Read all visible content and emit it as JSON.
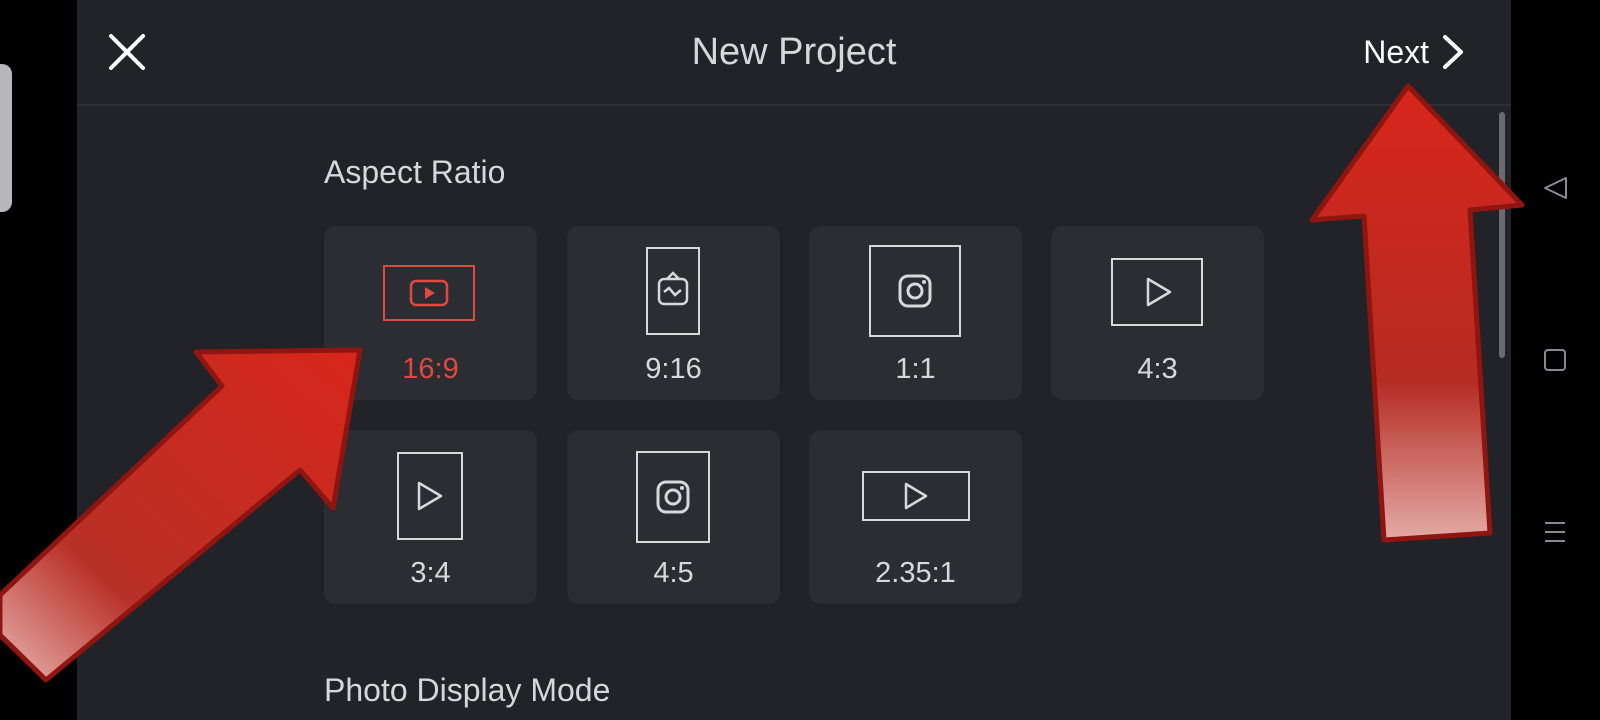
{
  "header": {
    "title": "New Project",
    "next_label": "Next"
  },
  "aspect_ratio": {
    "section_title": "Aspect Ratio",
    "selected": "16:9",
    "options": [
      {
        "label": "16:9",
        "icon": "youtube-icon"
      },
      {
        "label": "9:16",
        "icon": "igtv-icon"
      },
      {
        "label": "1:1",
        "icon": "instagram-icon"
      },
      {
        "label": "4:3",
        "icon": "play-icon"
      },
      {
        "label": "3:4",
        "icon": "play-icon"
      },
      {
        "label": "4:5",
        "icon": "instagram-icon"
      },
      {
        "label": "2.35:1",
        "icon": "play-icon"
      }
    ]
  },
  "photo_display": {
    "section_title": "Photo Display Mode"
  },
  "navigation": {
    "icons": [
      "back-icon",
      "home-icon",
      "menu-icon"
    ]
  },
  "colors": {
    "background": "#222328",
    "tile": "#2c2d32",
    "selected_accent": "#e1483f",
    "annotation_arrow": "#d8261b"
  }
}
